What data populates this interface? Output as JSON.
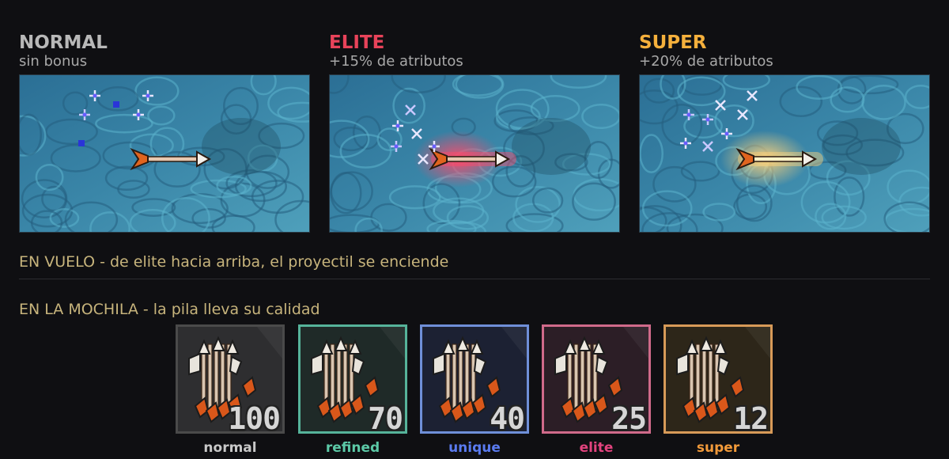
{
  "panels": [
    {
      "title": "NORMAL",
      "subtitle": "sin bonus",
      "color": "#b8b8b8",
      "glow": "none"
    },
    {
      "title": "ELITE",
      "subtitle": "+15% de atributos",
      "color": "#e8435a",
      "glow": "#ff4a6a"
    },
    {
      "title": "SUPER",
      "subtitle": "+20% de atributos",
      "color": "#f5b03c",
      "glow": "#ffd27a"
    }
  ],
  "flight_caption": "EN VUELO - de elite hacia arriba, el proyectil se enciende",
  "backpack_caption": "EN LA MOCHILA - la pila lleva su calidad",
  "stacks": [
    {
      "quality": "normal",
      "count": "100",
      "color": "#c8c8c8",
      "border": "#4a4a4a",
      "bg": "#2e2e30"
    },
    {
      "quality": "refined",
      "count": "70",
      "color": "#5cc9a7",
      "border": "#56b39a",
      "bg": "#1f2a28"
    },
    {
      "quality": "unique",
      "count": "40",
      "color": "#5a7bf0",
      "border": "#6f8fd8",
      "bg": "#1c2133"
    },
    {
      "quality": "elite",
      "count": "25",
      "color": "#e2437e",
      "border": "#d06a8a",
      "bg": "#2c1e26"
    },
    {
      "quality": "super",
      "count": "12",
      "color": "#f29a3a",
      "border": "#d79a58",
      "bg": "#2d2619"
    }
  ]
}
